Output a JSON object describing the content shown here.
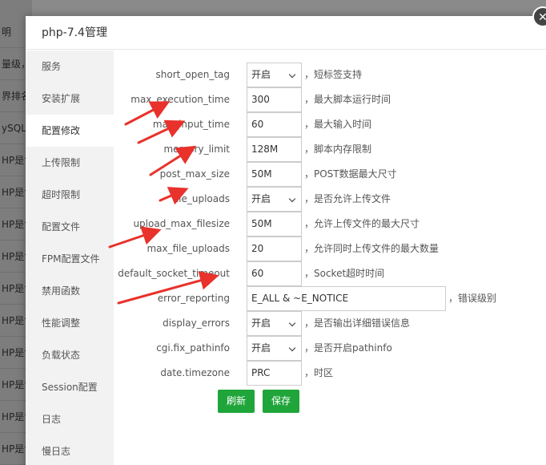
{
  "background_items": [
    "明",
    "量级，",
    "界排名",
    "ySQL是",
    "HP是世",
    "HP是世",
    "HP是世",
    "HP是世",
    "HP是世",
    "HP是世",
    "HP是世",
    "HP是世",
    "HP是世",
    "HP是世"
  ],
  "dialog": {
    "title": "php-7.4管理",
    "close_symbol": "✕"
  },
  "sidebar": {
    "items": [
      "服务",
      "安装扩展",
      "配置修改",
      "上传限制",
      "超时限制",
      "配置文件",
      "FPM配置文件",
      "禁用函数",
      "性能调整",
      "负载状态",
      "Session配置",
      "日志",
      "慢日志"
    ],
    "active_index": 2
  },
  "settings": [
    {
      "name": "short_open_tag",
      "value": "开启",
      "type": "select",
      "desc": "，短标签支持"
    },
    {
      "name": "max_execution_time",
      "value": "300",
      "type": "text",
      "desc": "，最大脚本运行时间"
    },
    {
      "name": "max_input_time",
      "value": "60",
      "type": "text",
      "desc": "，最大输入时间"
    },
    {
      "name": "memory_limit",
      "value": "128M",
      "type": "text",
      "desc": "，脚本内存限制"
    },
    {
      "name": "post_max_size",
      "value": "50M",
      "type": "text",
      "desc": "，POST数据最大尺寸"
    },
    {
      "name": "file_uploads",
      "value": "开启",
      "type": "select",
      "desc": "，是否允许上传文件"
    },
    {
      "name": "upload_max_filesize",
      "value": "50M",
      "type": "text",
      "desc": "，允许上传文件的最大尺寸"
    },
    {
      "name": "max_file_uploads",
      "value": "20",
      "type": "text",
      "desc": "，允许同时上传文件的最大数量"
    },
    {
      "name": "default_socket_timeout",
      "value": "60",
      "type": "text",
      "desc": "，Socket超时时间"
    },
    {
      "name": "error_reporting",
      "value": "E_ALL & ~E_NOTICE",
      "type": "wide",
      "desc": "，错误级别"
    },
    {
      "name": "display_errors",
      "value": "开启",
      "type": "select",
      "desc": "，是否输出详细错误信息"
    },
    {
      "name": "cgi.fix_pathinfo",
      "value": "开启",
      "type": "select",
      "desc": "，是否开启pathinfo"
    },
    {
      "name": "date.timezone",
      "value": "PRC",
      "type": "text",
      "desc": "，时区"
    }
  ],
  "buttons": {
    "refresh_label": "刷新",
    "save_label": "保存"
  },
  "colors": {
    "accent": "#20a53a",
    "annotation_arrow": "#e8322b"
  }
}
